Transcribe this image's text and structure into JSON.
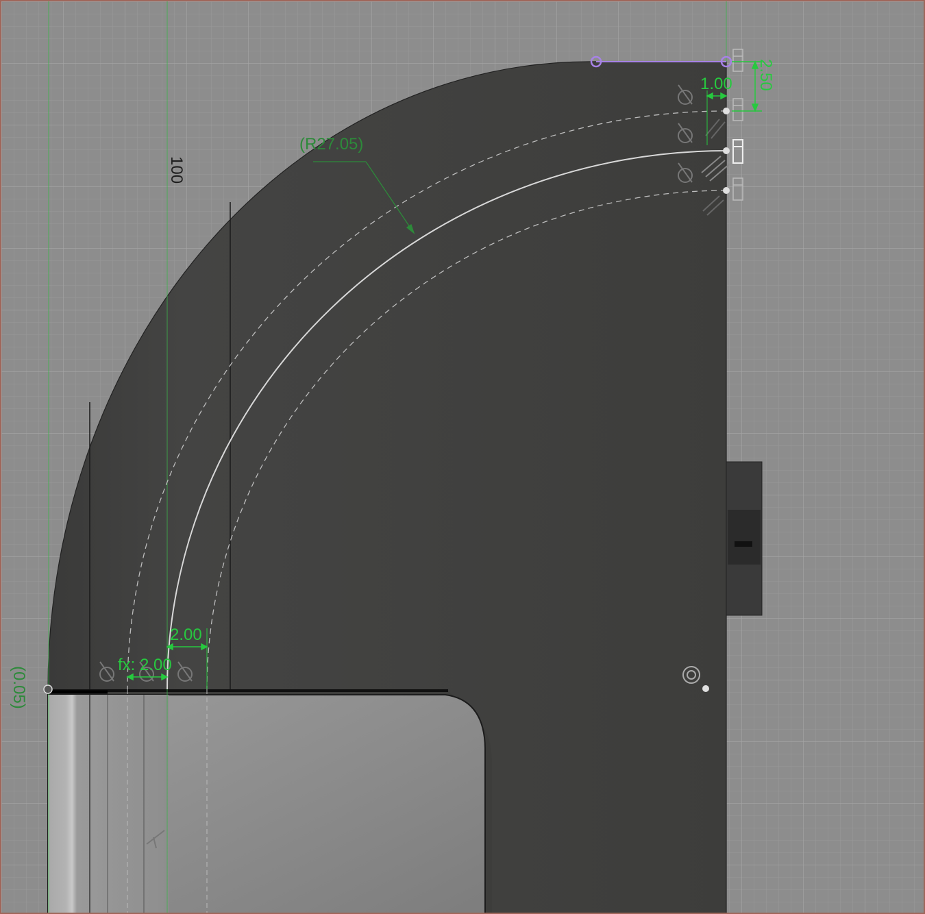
{
  "dimensions": {
    "radius_ref": "(R27.05)",
    "vertical_100": "100",
    "offset_1": "1.00",
    "offset_2_50": "2.50",
    "width_2_00": "2.00",
    "fx_2_00": "fx: 2.00",
    "ref_0_05": "(0.05)"
  },
  "colors": {
    "background": "#8d8d8d",
    "grid_minor": "#979797",
    "grid_major": "#a3a3a3",
    "body": "#3d3d3b",
    "body_edge": "#1f1f1f",
    "flange_light": "#b0b0b0",
    "flange_mid": "#8a8a8a",
    "dimension": "#27c93f",
    "dimension_ref": "#2d8a3a",
    "selection": "#a782e6",
    "axis": "#3bb34a"
  }
}
